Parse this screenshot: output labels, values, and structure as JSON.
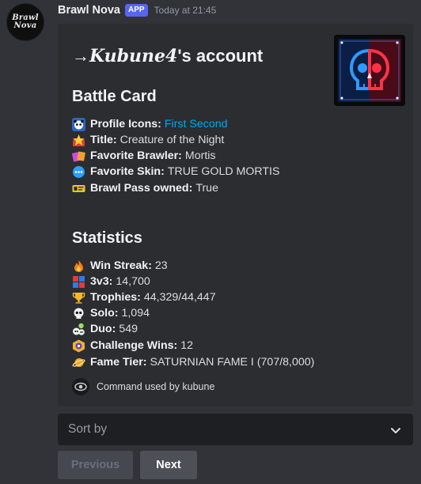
{
  "message": {
    "avatar": {
      "brand_line1": "Brawl",
      "brand_line2": "Nova",
      "brand_sub": ""
    },
    "username": "Brawl Nova",
    "app_tag": "APP",
    "timestamp": "Today at 21:45"
  },
  "embed": {
    "title_arrow": "→",
    "title_name": "Kubune4",
    "title_suffix": "'s account",
    "thumbnail_icon": "skull-icon",
    "battle_card": {
      "heading": "Battle Card",
      "fields": [
        {
          "icon": "panda-icon",
          "label": "Profile Icons:",
          "value": "First Second",
          "is_link": true
        },
        {
          "icon": "star-badge-icon",
          "label": "Title:",
          "value": "Creature of the Night"
        },
        {
          "icon": "brawler-card-icon",
          "label": "Favorite Brawler:",
          "value": "Mortis"
        },
        {
          "icon": "skin-bubble-icon",
          "label": "Favorite Skin:",
          "value": "TRUE GOLD MORTIS"
        },
        {
          "icon": "pass-ticket-icon",
          "label": "Brawl Pass owned:",
          "value": "True"
        }
      ]
    },
    "statistics": {
      "heading": "Statistics",
      "fields": [
        {
          "icon": "fire-icon",
          "label": "Win Streak:",
          "value": "23"
        },
        {
          "icon": "3v3-icon",
          "label": "3v3:",
          "value": "14,700"
        },
        {
          "icon": "trophy-icon",
          "label": "Trophies:",
          "value": "44,329/44,447"
        },
        {
          "icon": "solo-skull-icon",
          "label": "Solo:",
          "value": "1,094"
        },
        {
          "icon": "duo-skull-icon",
          "label": "Duo:",
          "value": "549"
        },
        {
          "icon": "challenge-icon",
          "label": "Challenge Wins:",
          "value": "12"
        },
        {
          "icon": "fame-icon",
          "label": "Fame Tier:",
          "value": "SATURNIAN FAME I (707/8,000)"
        }
      ]
    },
    "footer": {
      "text": "Command used by kubune",
      "icon": "eye-icon"
    }
  },
  "sort_select": {
    "placeholder": "Sort by",
    "icon": "chevron-down-icon"
  },
  "buttons": {
    "previous": "Previous",
    "next": "Next"
  },
  "colors": {
    "background": "#313338",
    "embed": "#2b2d31",
    "link": "#00a8fc",
    "app_tag": "#5865f2",
    "thumb_blue": "#1e90ff",
    "thumb_red": "#ff2a3c"
  }
}
